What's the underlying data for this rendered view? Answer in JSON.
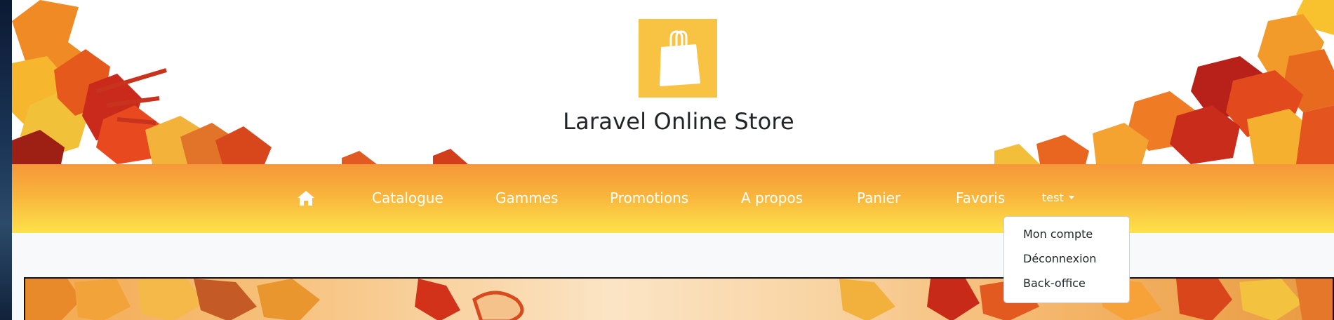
{
  "header": {
    "site_title": "Laravel Online Store",
    "logo_icon": "shopping-bag-icon",
    "logo_color": "#f8c343"
  },
  "navbar": {
    "home_icon": "home-icon",
    "items": [
      {
        "label": "Catalogue"
      },
      {
        "label": "Gammes"
      },
      {
        "label": "Promotions"
      },
      {
        "label": "A propos"
      },
      {
        "label": "Panier"
      },
      {
        "label": "Favoris"
      }
    ],
    "user_menu": {
      "label": "test",
      "expanded": true,
      "items": [
        {
          "label": "Mon compte"
        },
        {
          "label": "Déconnexion"
        },
        {
          "label": "Back-office"
        }
      ]
    }
  },
  "theme": {
    "navbar_gradient_top": "#f6973a",
    "navbar_gradient_bottom": "#fde24a",
    "page_background": "#f8f9fa"
  }
}
